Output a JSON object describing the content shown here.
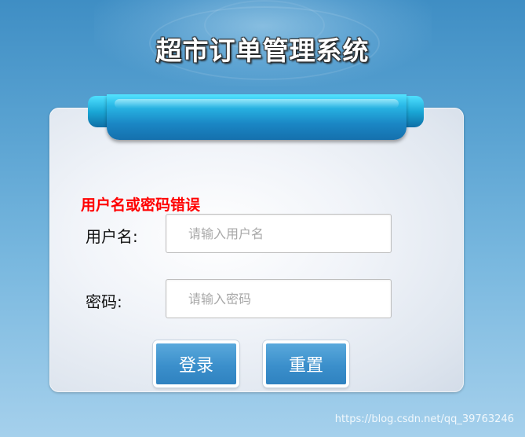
{
  "title": "超市订单管理系统",
  "login_form": {
    "error_message": "用户名或密码错误",
    "username": {
      "label": "用户名:",
      "placeholder": "请输入用户名",
      "value": ""
    },
    "password": {
      "label": "密码:",
      "placeholder": "请输入密码",
      "value": ""
    },
    "login_button": "登录",
    "reset_button": "重置"
  },
  "watermark": "https://blog.csdn.net/qq_39763246",
  "colors": {
    "error": "#ff0000",
    "button": "#3b8fcb",
    "ribbon": "#1a86c4",
    "background": "#5aa3d2"
  }
}
